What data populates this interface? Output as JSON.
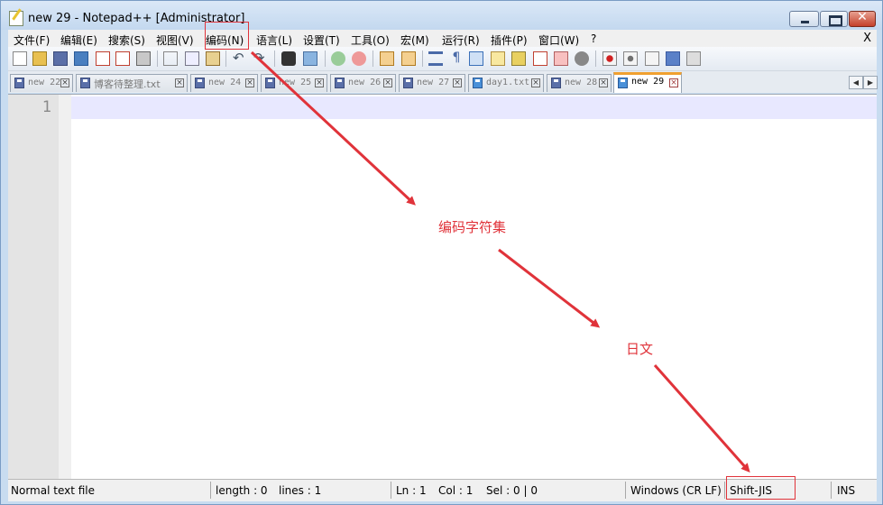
{
  "window": {
    "title": "new 29 - Notepad++ [Administrator]",
    "close_x": "X"
  },
  "menu": [
    "文件(F)",
    "编辑(E)",
    "搜索(S)",
    "视图(V)",
    "编码(N)",
    "语言(L)",
    "设置(T)",
    "工具(O)",
    "宏(M)",
    "运行(R)",
    "插件(P)",
    "窗口(W)",
    "?"
  ],
  "toolbar_icons": [
    "new-file-icon",
    "open-file-icon",
    "save-icon",
    "save-all-icon",
    "close-icon",
    "close-all-icon",
    "print-icon",
    "cut-icon",
    "copy-icon",
    "paste-icon",
    "undo-icon",
    "redo-icon",
    "find-icon",
    "replace-icon",
    "zoom-in-icon",
    "zoom-out-icon",
    "sync-vertical-icon",
    "sync-horizontal-icon",
    "word-wrap-icon",
    "show-all-chars-icon",
    "indent-guide-icon",
    "user-language-icon",
    "doc-map-icon",
    "function-list-icon",
    "folder-workspace-icon",
    "monitor-icon",
    "record-macro-icon",
    "stop-macro-icon",
    "play-macro-icon",
    "run-macro-multiple-icon",
    "save-macro-icon"
  ],
  "tabs": [
    {
      "label": "new 22",
      "x": "⊠"
    },
    {
      "label": "博客待整理.txt",
      "x": "⊠"
    },
    {
      "label": "new 24",
      "x": "⊠"
    },
    {
      "label": "new 25",
      "x": "⊠"
    },
    {
      "label": "new 26",
      "x": "⊠"
    },
    {
      "label": "new 27",
      "x": "⊠"
    },
    {
      "label": "day1.txt",
      "x": "⊠"
    },
    {
      "label": "new 28",
      "x": "⊠"
    },
    {
      "label": "new 29",
      "x": "⊠"
    }
  ],
  "tab_arrows": {
    "left": "◀",
    "right": "▶"
  },
  "editor": {
    "line_number": "1"
  },
  "status": {
    "type": "Normal text file",
    "length": "length : 0",
    "lines": "lines : 1",
    "ln": "Ln : 1",
    "col": "Col : 1",
    "sel": "Sel : 0 | 0",
    "eol": "Windows (CR LF)",
    "encoding": "Shift-JIS",
    "mode": "INS"
  },
  "annotations": {
    "charset_label": "编码字符集",
    "japanese_label": "日文",
    "color": "#e0333a"
  }
}
